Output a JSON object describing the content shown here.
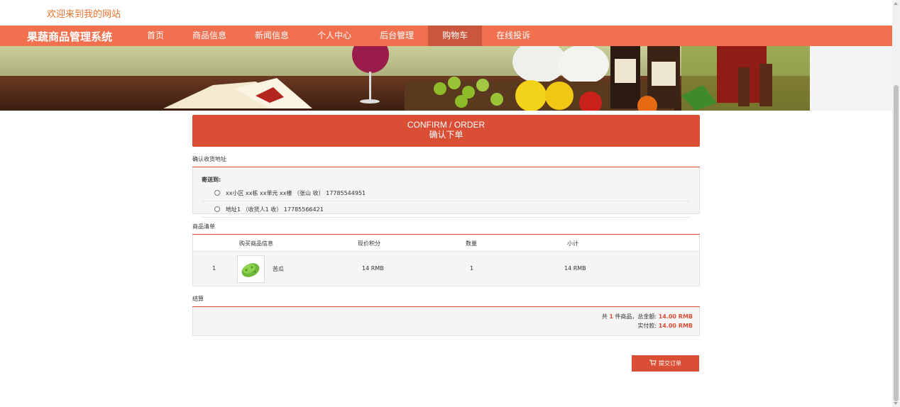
{
  "header": {
    "welcome": "欢迎来到我的网站"
  },
  "nav": {
    "brand": "果蔬商品管理系统",
    "items": [
      {
        "label": "首页"
      },
      {
        "label": "商品信息"
      },
      {
        "label": "新闻信息"
      },
      {
        "label": "个人中心"
      },
      {
        "label": "后台管理"
      },
      {
        "label": "购物车"
      },
      {
        "label": "在线投诉"
      }
    ],
    "active": "购物车"
  },
  "confirm": {
    "title_en": "CONFIRM / ORDER",
    "title_cn": "确认下单"
  },
  "address": {
    "section_title": "确认收货地址",
    "send_to": "寄送到:",
    "options": [
      {
        "text": "xx小区 xx栋 xx单元 xx楼 （张山 收） 17785544951"
      },
      {
        "text": "地址1 （收货人1 收） 17785566421"
      }
    ]
  },
  "goods": {
    "section_title": "商品清单",
    "headers": {
      "info": "购买商品信息",
      "price": "现价积分",
      "qty": "数量",
      "subtotal": "小计"
    },
    "rows": [
      {
        "index": "1",
        "name": "苦瓜",
        "price": "14 RMB",
        "qty": "1",
        "subtotal": "14 RMB"
      }
    ]
  },
  "settlement": {
    "section_title": "结算",
    "line1_prefix": "共",
    "count": "1",
    "line1_mid": "件商品，总金额:",
    "total": "14.00 RMB",
    "line2_prefix": "实付款:",
    "paid": "14.00 RMB"
  },
  "submit_label": "提交订单",
  "colors": {
    "nav": "#f07050",
    "accent": "#d94e34",
    "welcome": "#e8742f"
  }
}
